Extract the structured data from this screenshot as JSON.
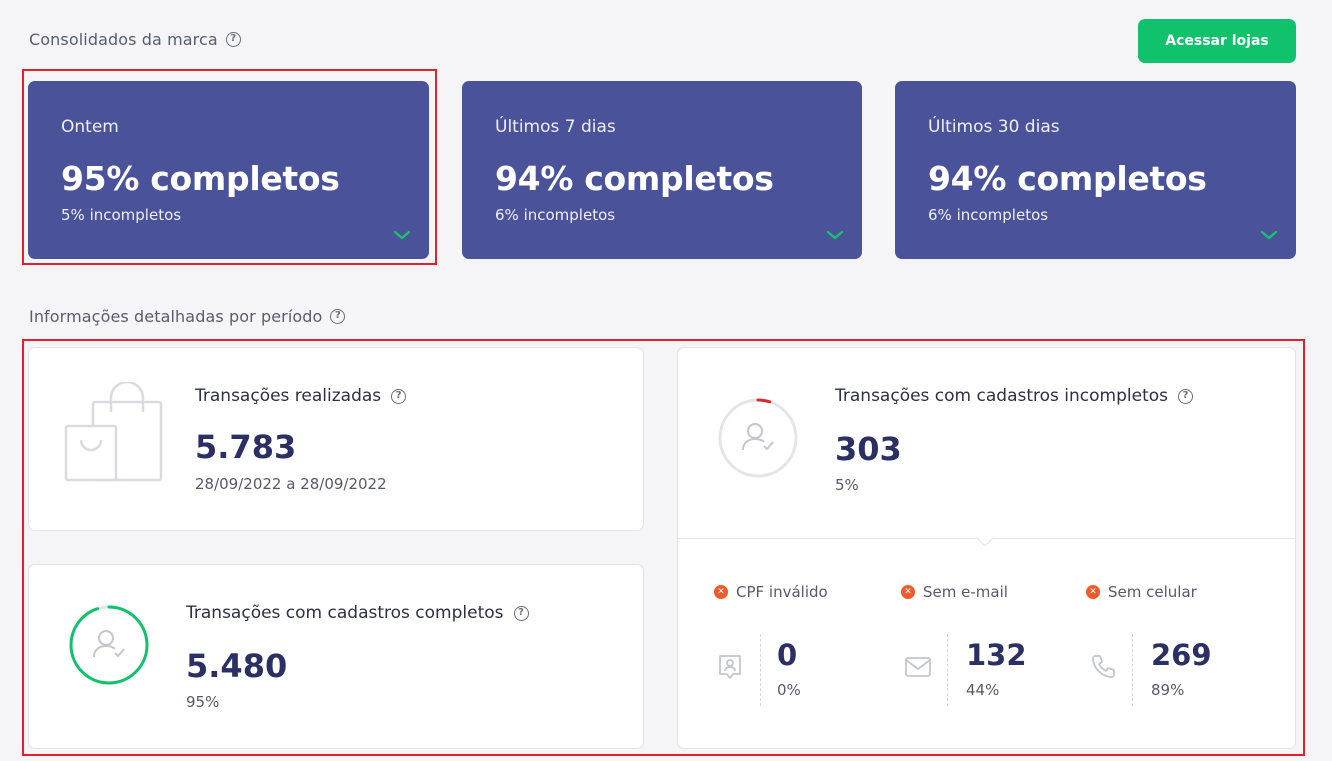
{
  "header": {
    "section1_title": "Consolidados da marca",
    "access_button": "Acessar lojas"
  },
  "summary_cards": [
    {
      "period": "Ontem",
      "complete": "95% completos",
      "incomplete": "5% incompletos"
    },
    {
      "period": "Últimos 7 dias",
      "complete": "94% completos",
      "incomplete": "6% incompletos"
    },
    {
      "period": "Últimos 30 dias",
      "complete": "94% completos",
      "incomplete": "6% incompletos"
    }
  ],
  "details": {
    "section2_title": "Informações detalhadas por período",
    "transactions": {
      "label": "Transações realizadas",
      "value": "5.783",
      "range": "28/09/2022 a 28/09/2022"
    },
    "complete": {
      "label": "Transações com cadastros completos",
      "value": "5.480",
      "percent": "95%",
      "ring_fraction": 0.95
    },
    "incomplete": {
      "label": "Transações com cadastros incompletos",
      "value": "303",
      "percent": "5%",
      "ring_fraction": 0.05,
      "breakdown": [
        {
          "label": "CPF inválido",
          "value": "0",
          "percent": "0%",
          "icon": "id-badge-icon"
        },
        {
          "label": "Sem e-mail",
          "value": "132",
          "percent": "44%",
          "icon": "envelope-icon"
        },
        {
          "label": "Sem celular",
          "value": "269",
          "percent": "89%",
          "icon": "phone-icon"
        }
      ]
    }
  },
  "colors": {
    "card_bg": "#4a5299",
    "accent_green": "#10c26b",
    "error_orange": "#f05a2b",
    "ring_red": "#d92b2b",
    "highlight_red": "#e0202b"
  }
}
